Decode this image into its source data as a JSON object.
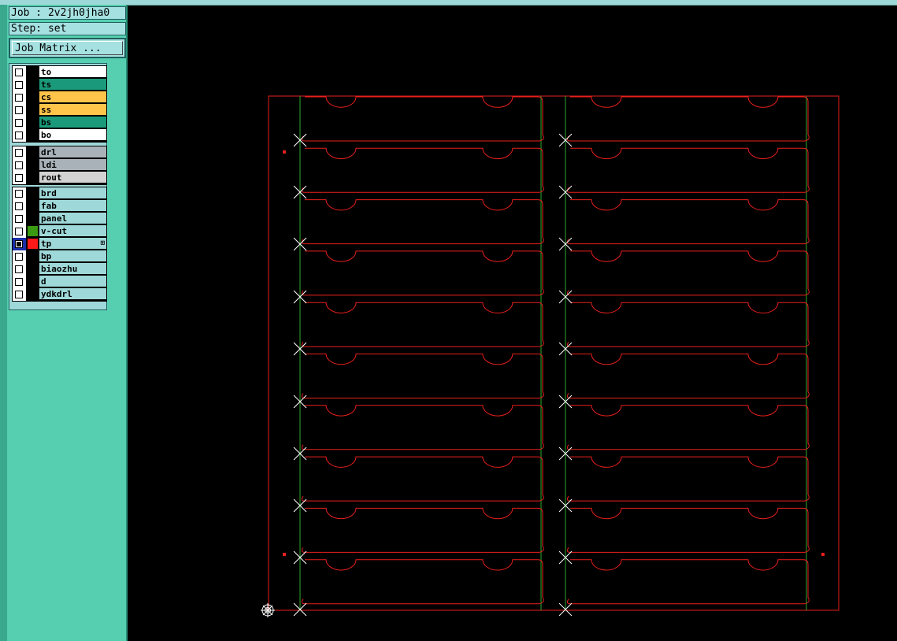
{
  "window": {
    "job_label": "Job : 2v2jh0jha0",
    "step_label": "Step: set",
    "job_matrix_button": "Job Matrix ..."
  },
  "layer_groups": [
    {
      "layers": [
        {
          "name": "to",
          "color": "#ffffff",
          "checked": false
        },
        {
          "name": "ts",
          "color": "#1a9a7a",
          "checked": false
        },
        {
          "name": "cs",
          "color": "#ffc44a",
          "checked": false
        },
        {
          "name": "ss",
          "color": "#ffc44a",
          "checked": false
        },
        {
          "name": "bs",
          "color": "#1a9a7a",
          "checked": false
        },
        {
          "name": "bo",
          "color": "#ffffff",
          "checked": false
        }
      ]
    },
    {
      "layers": [
        {
          "name": "drl",
          "color": "#a8b2b8",
          "checked": false
        },
        {
          "name": "ldi",
          "color": "#a8b2b8",
          "checked": false
        },
        {
          "name": "rout",
          "color": "#d3d3d3",
          "checked": false
        }
      ]
    },
    {
      "layers": [
        {
          "name": "brd",
          "color": "#9fd8d8",
          "checked": false
        },
        {
          "name": "fab",
          "color": "#9fd8d8",
          "checked": false
        },
        {
          "name": "panel",
          "color": "#9fd8d8",
          "checked": false
        },
        {
          "name": "v-cut",
          "color": "#9fd8d8",
          "checked": false,
          "swatch": "#3a9a10"
        },
        {
          "name": "tp",
          "color": "#9fd8d8",
          "checked": true,
          "swatch": "#ff1a1a",
          "selected": true,
          "mark": "⊞"
        },
        {
          "name": "bp",
          "color": "#9fd8d8",
          "checked": false
        },
        {
          "name": "biaozhu",
          "color": "#9fd8d8",
          "checked": false
        },
        {
          "name": "d",
          "color": "#9fd8d8",
          "checked": false
        },
        {
          "name": "ydkdrl",
          "color": "#9fd8d8",
          "checked": false
        }
      ]
    }
  ],
  "colors": {
    "outline": "#e8201c",
    "vcut": "#2eaa2e",
    "marker": "#ffffff",
    "background": "#000000"
  },
  "icons": {
    "fiducial": "crosshair-icon",
    "drill": "x-mark-icon"
  }
}
